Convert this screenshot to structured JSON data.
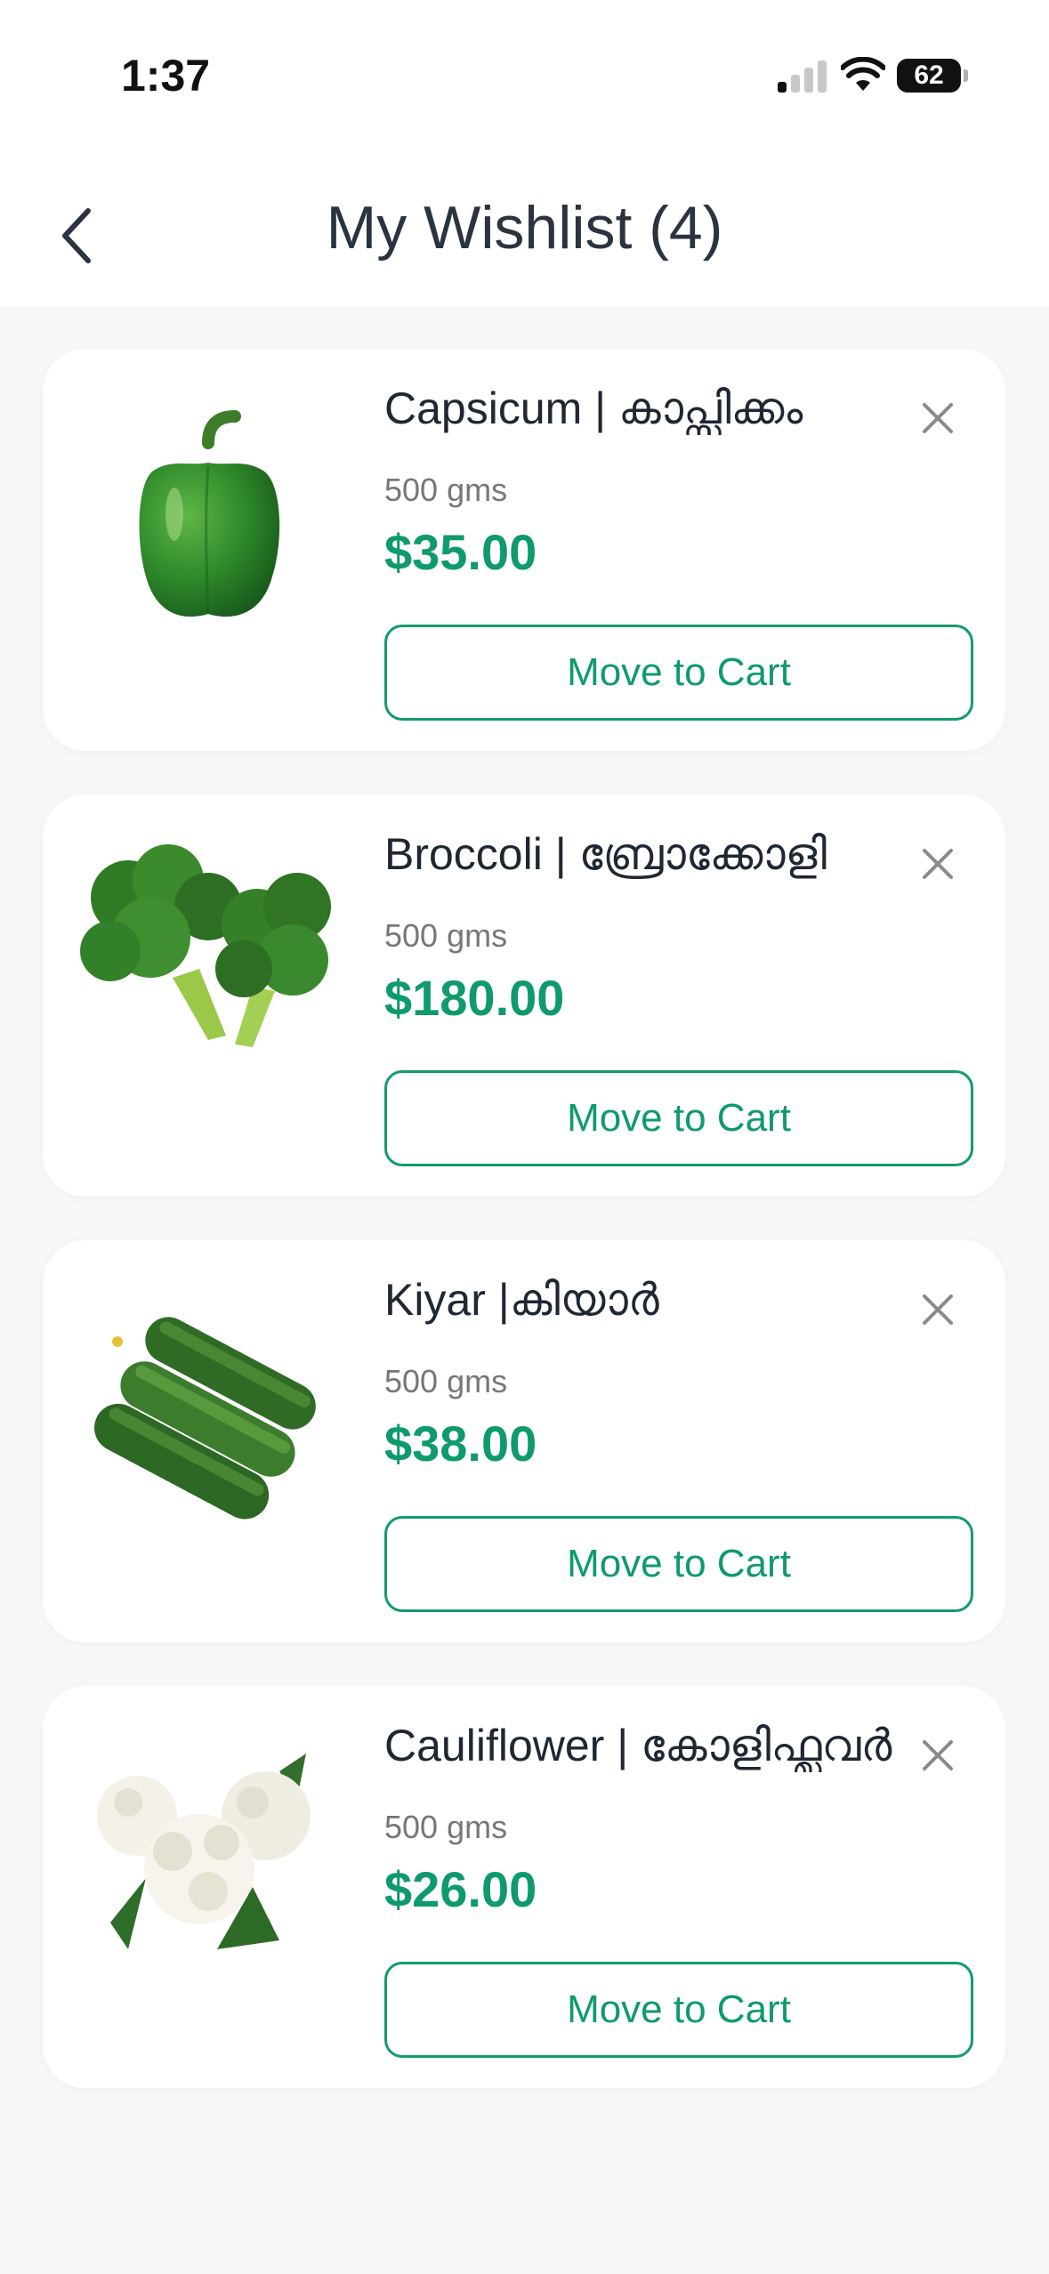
{
  "status_bar": {
    "time": "1:37",
    "battery": "62"
  },
  "header": {
    "title": "My Wishlist (4)"
  },
  "colors": {
    "accent": "#0f9a6e",
    "title": "#2b3340"
  },
  "items": [
    {
      "name": "Capsicum |  കാപ്സിക്കം",
      "qty": "500 gms",
      "price": "$35.00",
      "cart_label": "Move to Cart",
      "image": "green-capsicum"
    },
    {
      "name": "Broccoli | ബ്രോക്കോളി",
      "qty": "500 gms",
      "price": "$180.00",
      "cart_label": "Move to Cart",
      "image": "broccoli"
    },
    {
      "name": "Kiyar |കിയാർ",
      "qty": "500 gms",
      "price": "$38.00",
      "cart_label": "Move to Cart",
      "image": "cucumbers"
    },
    {
      "name": "Cauliflower | കോളിഫ്ലവർ",
      "qty": "500 gms",
      "price": "$26.00",
      "cart_label": "Move to Cart",
      "image": "cauliflower"
    }
  ]
}
